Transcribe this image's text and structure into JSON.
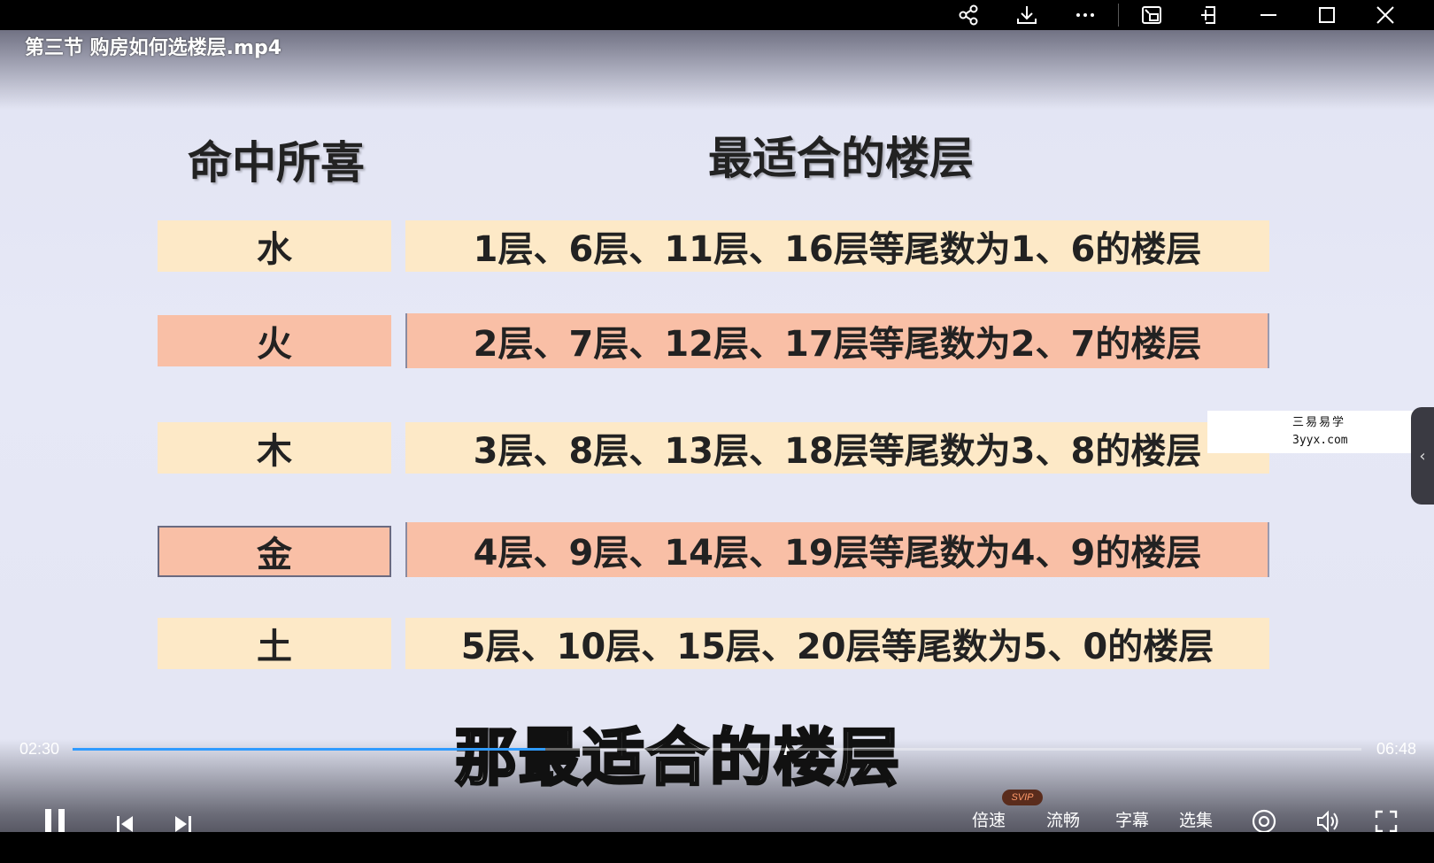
{
  "window": {
    "title": "第三节 购房如何选楼层.mp4",
    "icons": [
      "share-icon",
      "download-icon",
      "more-icon",
      "picture-in-picture-icon",
      "pin-icon",
      "minimize-icon",
      "maximize-icon",
      "close-icon"
    ]
  },
  "slide": {
    "header_left": "命中所喜",
    "header_right": "最适合的楼层",
    "rows": [
      {
        "element": "水",
        "floors": "1层、6层、11层、16层等尾数为1、6的楼层",
        "color": "#fde9c7"
      },
      {
        "element": "火",
        "floors": "2层、7层、12层、17层等尾数为2、7的楼层",
        "color": "#f9bfa6"
      },
      {
        "element": "木",
        "floors": "3层、8层、13层、18层等尾数为3、8的楼层",
        "color": "#fde9c7"
      },
      {
        "element": "金",
        "floors": "4层、9层、14层、19层等尾数为4、9的楼层",
        "color": "#f9bfa6"
      },
      {
        "element": "土",
        "floors": "5层、10层、15层、20层等尾数为5、0的楼层",
        "color": "#fde9c7"
      }
    ]
  },
  "watermark": {
    "line1": "三易易学",
    "line2": "3yyx.com"
  },
  "subtitle": "那最适合的楼层",
  "player": {
    "current_time": "02:30",
    "duration": "06:48",
    "progress": 0.367,
    "accent_color": "#2f9bff",
    "speed_label": "倍速",
    "speed_badge": "SVIP",
    "quality_label": "流畅",
    "subtitle_label": "字幕",
    "episodes_label": "选集"
  }
}
